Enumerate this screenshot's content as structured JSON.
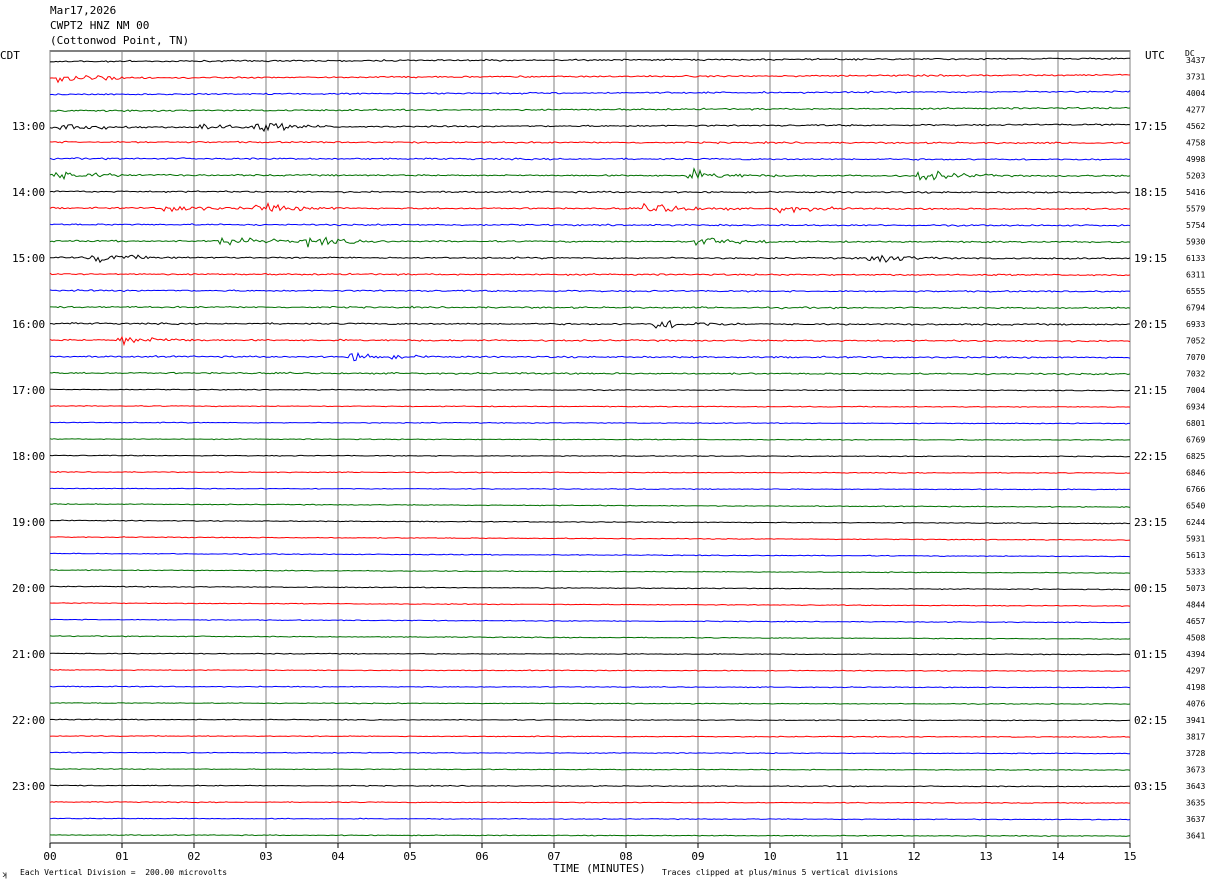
{
  "header": {
    "date": "Mar17,2026",
    "station": "CWPT2 HNZ NM 00",
    "location": "(Cottonwod Point, TN)"
  },
  "labels": {
    "left_tz": "CDT",
    "right_tz": "UTC",
    "dc": "DC",
    "x_axis": "TIME (MINUTES)",
    "scale_note": "Each Vertical Division =  200.00 microvolts",
    "clip_note": "Traces clipped at plus/minus 5 vertical divisions",
    "corner_mark": "ʞ"
  },
  "chart_data": {
    "type": "helicorder",
    "xlabel": "TIME (MINUTES)",
    "xlim": [
      0,
      15
    ],
    "x_ticks": [
      "00",
      "01",
      "02",
      "03",
      "04",
      "05",
      "06",
      "07",
      "08",
      "09",
      "10",
      "11",
      "12",
      "13",
      "14",
      "15"
    ],
    "row_count": 48,
    "rows_per_hour": 4,
    "left_hour_labels": [
      "13:00",
      "14:00",
      "15:00",
      "16:00",
      "17:00",
      "18:00",
      "19:00",
      "20:00",
      "21:00",
      "22:00",
      "23:00"
    ],
    "right_hour_labels": [
      "17:15",
      "18:15",
      "19:15",
      "20:15",
      "21:15",
      "22:15",
      "23:15",
      "00:15",
      "01:15",
      "02:15",
      "03:15"
    ],
    "hour_label_first_row": 4,
    "trace_colors": [
      "#000000",
      "#ff0000",
      "#0000ff",
      "#007000"
    ],
    "dc_values": [
      "3437",
      "3731",
      "4004",
      "4277",
      "4562",
      "4758",
      "4998",
      "5203",
      "5416",
      "5579",
      "5754",
      "5930",
      "6133",
      "6311",
      "6555",
      "6794",
      "6933",
      "7052",
      "7070",
      "7032",
      "7004",
      "6934",
      "6801",
      "6769",
      "6825",
      "6846",
      "6766",
      "6540",
      "6244",
      "5931",
      "5613",
      "5333",
      "5073",
      "4844",
      "4657",
      "4508",
      "4394",
      "4297",
      "4198",
      "4076",
      "3941",
      "3817",
      "3728",
      "3673",
      "3643",
      "3635",
      "3637",
      "3641"
    ],
    "quake_events": [
      {
        "row": 1,
        "minute": 0.15,
        "amp": 9
      },
      {
        "row": 4,
        "minute": 0.2,
        "amp": 7
      },
      {
        "row": 4,
        "minute": 2.1,
        "amp": 7
      },
      {
        "row": 4,
        "minute": 2.9,
        "amp": 8
      },
      {
        "row": 7,
        "minute": 0.1,
        "amp": 7
      },
      {
        "row": 7,
        "minute": 8.9,
        "amp": 8
      },
      {
        "row": 7,
        "minute": 12.1,
        "amp": 9
      },
      {
        "row": 9,
        "minute": 1.6,
        "amp": 7
      },
      {
        "row": 9,
        "minute": 2.9,
        "amp": 8
      },
      {
        "row": 9,
        "minute": 8.3,
        "amp": 10
      },
      {
        "row": 9,
        "minute": 10.1,
        "amp": 6
      },
      {
        "row": 11,
        "minute": 2.4,
        "amp": 9
      },
      {
        "row": 11,
        "minute": 3.6,
        "amp": 8
      },
      {
        "row": 11,
        "minute": 9.0,
        "amp": 9
      },
      {
        "row": 12,
        "minute": 0.6,
        "amp": 8
      },
      {
        "row": 12,
        "minute": 11.4,
        "amp": 8
      },
      {
        "row": 16,
        "minute": 8.4,
        "amp": 10
      },
      {
        "row": 17,
        "minute": 1.0,
        "amp": 8
      },
      {
        "row": 18,
        "minute": 4.2,
        "amp": 7
      }
    ]
  }
}
